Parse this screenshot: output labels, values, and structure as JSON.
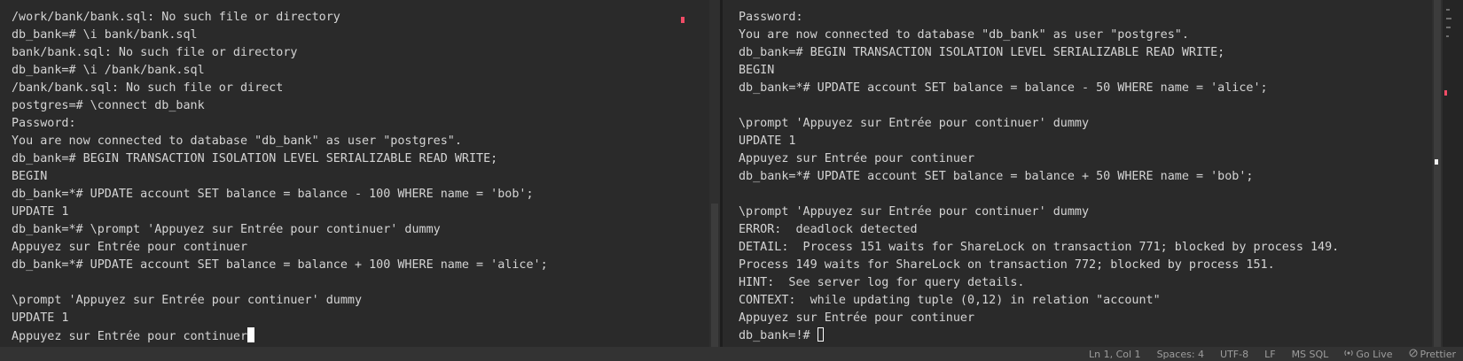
{
  "colors": {
    "terminal_bg": "#2a2a2a",
    "text": "#d4d4d4",
    "accent_tab": "#d7ba3d",
    "scroll_marker": "#f14c66",
    "statusbar_bg": "#333333"
  },
  "terminals": [
    {
      "lines": [
        "/work/bank/bank.sql: No such file or directory",
        "db_bank=# \\i bank/bank.sql",
        "bank/bank.sql: No such file or directory",
        "db_bank=# \\i /bank/bank.sql",
        "/bank/bank.sql: No such file or direct",
        "postgres=# \\connect db_bank",
        "Password:",
        "You are now connected to database \"db_bank\" as user \"postgres\".",
        "db_bank=# BEGIN TRANSACTION ISOLATION LEVEL SERIALIZABLE READ WRITE;",
        "BEGIN",
        "db_bank=*# UPDATE account SET balance = balance - 100 WHERE name = 'bob';",
        "UPDATE 1",
        "db_bank=*# \\prompt 'Appuyez sur Entrée pour continuer' dummy",
        "Appuyez sur Entrée pour continuer",
        "db_bank=*# UPDATE account SET balance = balance + 100 WHERE name = 'alice';",
        "",
        "\\prompt 'Appuyez sur Entrée pour continuer' dummy",
        "UPDATE 1",
        "Appuyez sur Entrée pour continuer"
      ]
    },
    {
      "lines": [
        "Password:",
        "You are now connected to database \"db_bank\" as user \"postgres\".",
        "db_bank=# BEGIN TRANSACTION ISOLATION LEVEL SERIALIZABLE READ WRITE;",
        "BEGIN",
        "db_bank=*# UPDATE account SET balance = balance - 50 WHERE name = 'alice';",
        "",
        "\\prompt 'Appuyez sur Entrée pour continuer' dummy",
        "UPDATE 1",
        "Appuyez sur Entrée pour continuer",
        "db_bank=*# UPDATE account SET balance = balance + 50 WHERE name = 'bob';",
        "",
        "\\prompt 'Appuyez sur Entrée pour continuer' dummy",
        "ERROR:  deadlock detected",
        "DETAIL:  Process 151 waits for ShareLock on transaction 771; blocked by process 149.",
        "Process 149 waits for ShareLock on transaction 772; blocked by process 151.",
        "HINT:  See server log for query details.",
        "CONTEXT:  while updating tuple (0,12) in relation \"account\"",
        "Appuyez sur Entrée pour continuer",
        "db_bank=!# "
      ]
    }
  ],
  "statusbar": {
    "position": "Ln 1, Col 1",
    "spaces": "Spaces: 4",
    "encoding": "UTF-8",
    "eol": "LF",
    "language": "MS SQL",
    "golive": "Go Live",
    "prettier": "Prettier",
    "golive_icon": "broadcast-icon",
    "prettier_icon": "prettier-check-icon"
  }
}
